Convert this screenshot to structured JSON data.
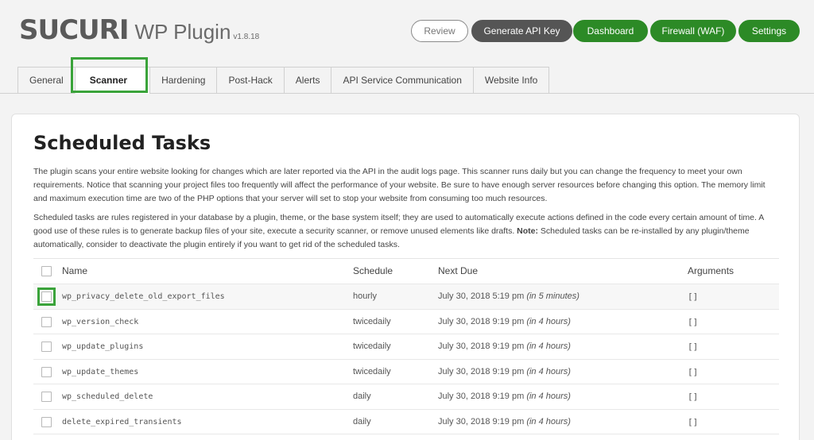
{
  "header": {
    "brand": "SUCURI",
    "product": "WP Plugin",
    "version": "v1.8.18",
    "buttons": {
      "review": "Review",
      "generate_api_key": "Generate API Key",
      "dashboard": "Dashboard",
      "firewall": "Firewall (WAF)",
      "settings": "Settings"
    }
  },
  "tabs": [
    {
      "label": "General"
    },
    {
      "label": "Scanner",
      "active": true
    },
    {
      "label": "Hardening"
    },
    {
      "label": "Post-Hack"
    },
    {
      "label": "Alerts"
    },
    {
      "label": "API Service Communication"
    },
    {
      "label": "Website Info"
    }
  ],
  "main": {
    "title": "Scheduled Tasks",
    "paragraph1": "The plugin scans your entire website looking for changes which are later reported via the API in the audit logs page. This scanner runs daily but you can change the frequency to meet your own requirements. Notice that scanning your project files too frequently will affect the performance of your website. Be sure to have enough server resources before changing this option. The memory limit and maximum execution time are two of the PHP options that your server will set to stop your website from consuming too much resources.",
    "paragraph2_part1": "Scheduled tasks are rules registered in your database by a plugin, theme, or the base system itself; they are used to automatically execute actions defined in the code every certain amount of time. A good use of these rules is to generate backup files of your site, execute a security scanner, or remove unused elements like drafts. ",
    "paragraph2_note_label": "Note:",
    "paragraph2_part2": " Scheduled tasks can be re-installed by any plugin/theme automatically, consider to deactivate the plugin entirely if you want to get rid of the scheduled tasks."
  },
  "table": {
    "columns": {
      "name": "Name",
      "schedule": "Schedule",
      "next_due": "Next Due",
      "arguments": "Arguments"
    },
    "rows": [
      {
        "name": "wp_privacy_delete_old_export_files",
        "schedule": "hourly",
        "next_due": "July 30, 2018 5:19 pm",
        "relative": "(in 5 minutes)",
        "arguments": "[]"
      },
      {
        "name": "wp_version_check",
        "schedule": "twicedaily",
        "next_due": "July 30, 2018 9:19 pm",
        "relative": "(in 4 hours)",
        "arguments": "[]"
      },
      {
        "name": "wp_update_plugins",
        "schedule": "twicedaily",
        "next_due": "July 30, 2018 9:19 pm",
        "relative": "(in 4 hours)",
        "arguments": "[]"
      },
      {
        "name": "wp_update_themes",
        "schedule": "twicedaily",
        "next_due": "July 30, 2018 9:19 pm",
        "relative": "(in 4 hours)",
        "arguments": "[]"
      },
      {
        "name": "wp_scheduled_delete",
        "schedule": "daily",
        "next_due": "July 30, 2018 9:19 pm",
        "relative": "(in 4 hours)",
        "arguments": "[]"
      },
      {
        "name": "delete_expired_transients",
        "schedule": "daily",
        "next_due": "July 30, 2018 9:19 pm",
        "relative": "(in 4 hours)",
        "arguments": "[]"
      }
    ]
  },
  "colors": {
    "accent_green": "#2c8a26",
    "highlight_green": "#3aa33a",
    "dark_button": "#555555"
  }
}
